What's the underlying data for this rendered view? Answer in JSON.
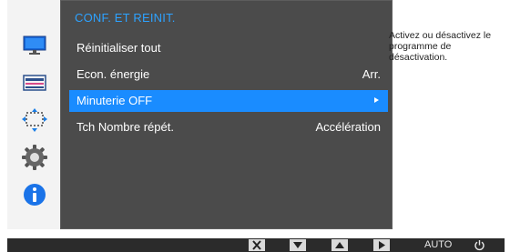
{
  "menu": {
    "title": "CONF. ET REINIT.",
    "items": [
      {
        "label": "Réinitialiser tout",
        "value": ""
      },
      {
        "label": "Econ. énergie",
        "value": "Arr."
      },
      {
        "label": "Minuterie OFF",
        "value": "",
        "selected": true
      },
      {
        "label": "Tch Nombre répét.",
        "value": "Accélération"
      }
    ]
  },
  "help": {
    "text": "Activez ou désactivez le programme de désactivation."
  },
  "sidebar": {
    "icons": [
      "picture-icon",
      "onscreen-display-icon",
      "position-icon",
      "setup-icon",
      "information-icon"
    ],
    "active": "setup-icon"
  },
  "buttons": {
    "icons": [
      "close-button-icon",
      "down-arrow-icon",
      "up-arrow-icon",
      "right-arrow-icon"
    ],
    "auto_label": "AUTO",
    "power_icon": "power-icon"
  },
  "colors": {
    "accent": "#1a8cff",
    "title": "#2da2ff",
    "panel": "#4b4b4b",
    "frame": "#2e2e2e"
  }
}
